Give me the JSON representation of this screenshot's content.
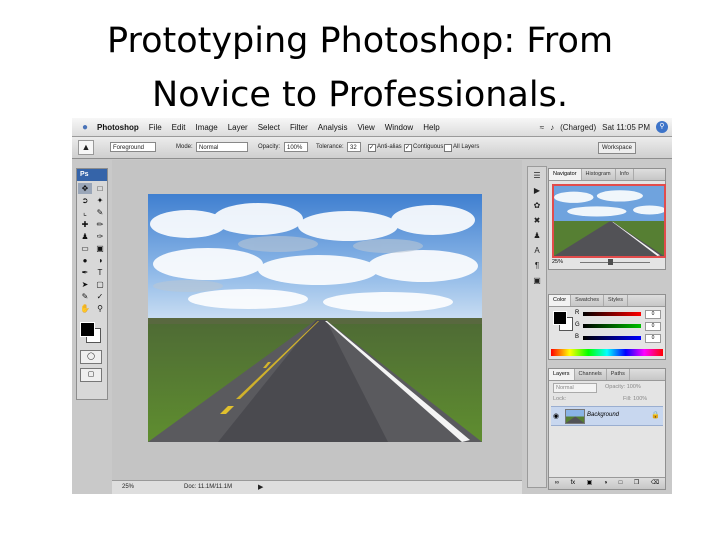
{
  "slide": {
    "title_line1": "Prototyping Photoshop: From",
    "title_line2": "Novice to Professionals."
  },
  "menubar": {
    "app": "Photoshop",
    "items": [
      "File",
      "Edit",
      "Image",
      "Layer",
      "Select",
      "Filter",
      "Analysis",
      "View",
      "Window",
      "Help"
    ],
    "battery": "(Charged)",
    "clock": "Sat 11:05 PM"
  },
  "options": {
    "preset": "Foreground",
    "mode_label": "Mode:",
    "mode_value": "Normal",
    "opacity_label": "Opacity:",
    "opacity_value": "100%",
    "tolerance_label": "Tolerance:",
    "tolerance_value": "32",
    "antialias": "Anti-alias",
    "contiguous": "Contiguous",
    "all_layers": "All Layers",
    "workspace": "Workspace"
  },
  "tools": {
    "logo": "Ps"
  },
  "status": {
    "zoom": "25%",
    "doc": "Doc: 11.1M/11.1M"
  },
  "navigator": {
    "tabs": [
      "Navigator",
      "Histogram",
      "Info"
    ],
    "zoom": "25%"
  },
  "color_panel": {
    "tabs": [
      "Color",
      "Swatches",
      "Styles"
    ],
    "channels": [
      {
        "label": "R",
        "value": "0",
        "gradient": "#ff0000"
      },
      {
        "label": "G",
        "value": "0",
        "gradient": "#00c000"
      },
      {
        "label": "B",
        "value": "0",
        "gradient": "#0000ff"
      }
    ]
  },
  "layers_panel": {
    "tabs": [
      "Layers",
      "Channels",
      "Paths"
    ],
    "mode": "Normal",
    "opacity_label": "Opacity:",
    "opacity_value": "100%",
    "lock_label": "Lock:",
    "fill_label": "Fill:",
    "fill_value": "100%",
    "layer_name": "Background"
  }
}
